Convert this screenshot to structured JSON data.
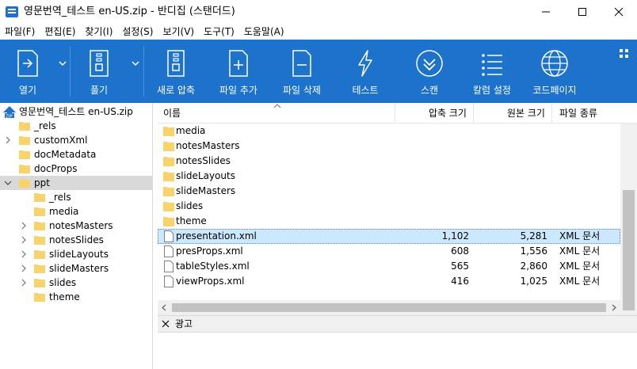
{
  "window": {
    "title": "영문번역_테스트 en-US.zip - 반디집 (스탠더드)"
  },
  "menu": [
    "파일(F)",
    "편집(E)",
    "찾기(I)",
    "설정(S)",
    "보기(V)",
    "도구(T)",
    "도움말(A)"
  ],
  "toolbar": {
    "open": "열기",
    "extract": "풀기",
    "new_archive": "새로 압축",
    "add_file": "파일 추가",
    "delete_file": "파일 삭제",
    "test": "테스트",
    "scan": "스캔",
    "columns": "칼럼 설정",
    "codepage": "코드페이지"
  },
  "tree": {
    "root": "영문번역_테스트 en-US.zip",
    "items": [
      "_rels",
      "customXml",
      "docMetadata",
      "docProps",
      "ppt"
    ],
    "ppt_children": [
      "_rels",
      "media",
      "notesMasters",
      "notesSlides",
      "slideLayouts",
      "slideMasters",
      "slides",
      "theme"
    ]
  },
  "list": {
    "headers": {
      "name": "이름",
      "packed": "압축 크기",
      "original": "원본 크기",
      "type": "파일 종류"
    },
    "folders": [
      "media",
      "notesMasters",
      "notesSlides",
      "slideLayouts",
      "slideMasters",
      "slides",
      "theme"
    ],
    "files": [
      {
        "name": "presentation.xml",
        "packed": "1,102",
        "original": "5,281",
        "type": "XML 문서"
      },
      {
        "name": "presProps.xml",
        "packed": "608",
        "original": "1,556",
        "type": "XML 문서"
      },
      {
        "name": "tableStyles.xml",
        "packed": "565",
        "original": "2,860",
        "type": "XML 문서"
      },
      {
        "name": "viewProps.xml",
        "packed": "416",
        "original": "1,025",
        "type": "XML 문서"
      }
    ]
  },
  "ad": {
    "label": "광고"
  },
  "colors": {
    "toolbar": "#1d72cc",
    "folder": "#f8d26a",
    "selection": "#cce8ff"
  }
}
